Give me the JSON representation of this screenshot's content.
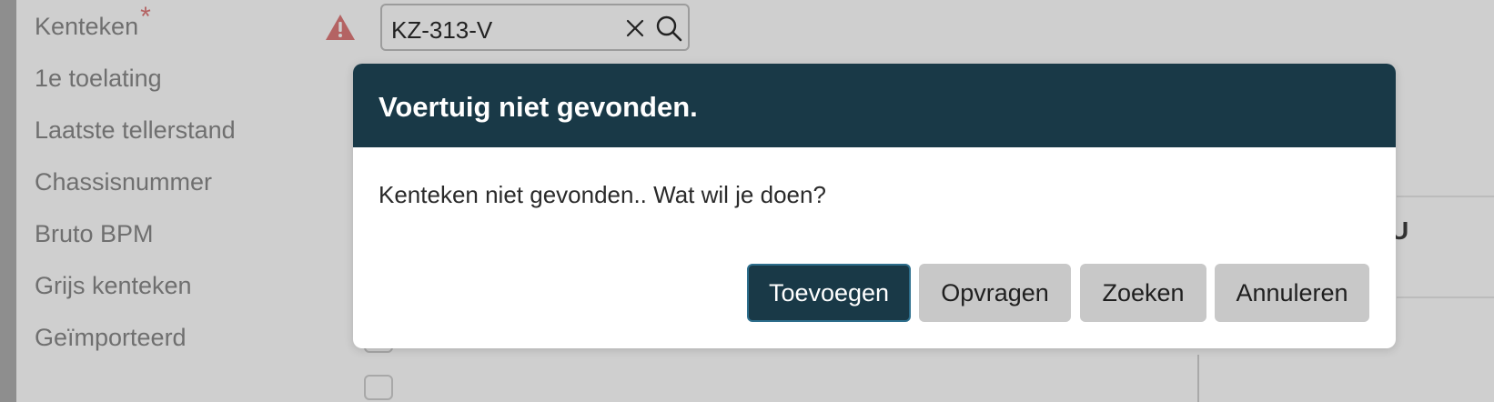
{
  "form": {
    "fields": [
      {
        "label": "Kenteken",
        "required_marker": "*"
      },
      {
        "label": "1e toelating"
      },
      {
        "label": "Laatste tellerstand"
      },
      {
        "label": "Chassisnummer"
      },
      {
        "label": "Bruto BPM"
      },
      {
        "label": "Grijs kenteken"
      },
      {
        "label": "Geïmporteerd"
      }
    ],
    "license_plate": {
      "value": "KZ-313-V"
    },
    "warning_icon": "warning-triangle-icon",
    "clear_icon": "close-icon",
    "search_icon": "search-icon"
  },
  "dialog": {
    "title": "Voertuig niet gevonden.",
    "message": "Kenteken niet gevonden.. Wat wil je doen?",
    "buttons": {
      "add": "Toevoegen",
      "request": "Opvragen",
      "search": "Zoeken",
      "cancel": "Annuleren"
    }
  },
  "colors": {
    "dialog_header": "#193947",
    "primary_button": "#193947",
    "secondary_button": "#c8c8c8",
    "warning": "#b46363"
  }
}
